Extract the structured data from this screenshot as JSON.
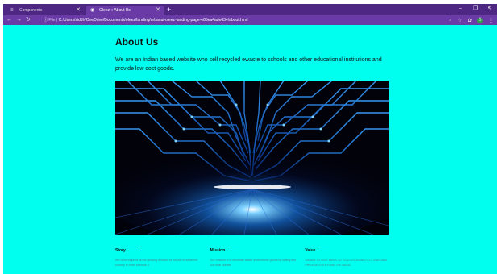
{
  "browser": {
    "tabs": [
      {
        "label": "Components",
        "icon": "dev-icon"
      },
      {
        "label": "Oleez :: About Us",
        "icon": "globe-icon"
      }
    ],
    "address_label": "File",
    "url": "C:/Users/siddh/OneDrive/Documents/oleez/landing/urbanui-oleez-landing-page-e85ea4ade634/about.html",
    "new_tab_glyph": "+",
    "avatar_letter": "S"
  },
  "page": {
    "title": "About Us",
    "intro": "We are an Indian based website who sell recycled ewaste to schools and other educational institutions and provide low cost goods.",
    "hero_image": "circuit-board-illustration",
    "columns": [
      {
        "heading": "Story",
        "text": "We were inspired as the growing demand to include in within the country in order to make a"
      },
      {
        "heading": "Mission",
        "text": "Our mission is to eliminate waste of electronic goods by selling it to our rural scenes"
      },
      {
        "heading": "Value",
        "text": "WE AIM TO GIVE WAYS TO EDUCATION INSTITUTIONS AND PROVIDE EVERYONE THE BASIC"
      }
    ]
  },
  "colors": {
    "page_bg": "#00ffee",
    "browser_chrome": "#4e2684",
    "hero_accent": "#1e90ff"
  }
}
